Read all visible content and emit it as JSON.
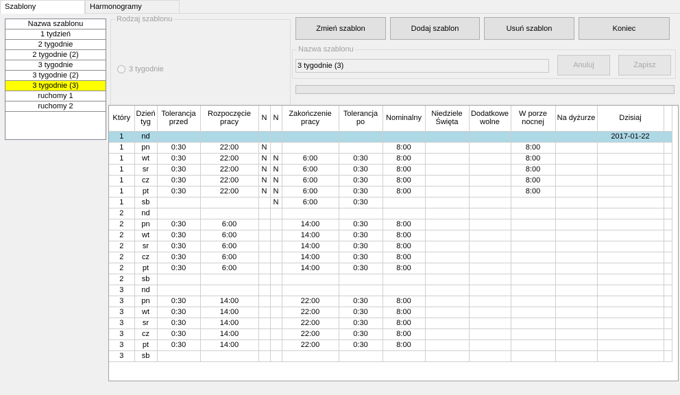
{
  "tabs": [
    {
      "label": "Szablony",
      "active": true
    },
    {
      "label": "Harmonogramy",
      "active": false
    }
  ],
  "template_list": {
    "header": "Nazwa szablonu",
    "items": [
      "1 tydzień",
      "2 tygodnie",
      "2 tygodnie (2)",
      "3 tygodnie",
      "3 tygodnie (2)",
      "3 tygodnie (3)",
      "ruchomy 1",
      "ruchomy 2"
    ],
    "selected_index": 5,
    "selected_color": "#ffff00"
  },
  "template_type": {
    "legend": "Rodzaj szablonu",
    "radio_label": "3 tygodnie"
  },
  "buttons": {
    "change": "Zmień szablon",
    "add": "Dodaj szablon",
    "delete": "Usuń szablon",
    "end": "Koniec",
    "cancel": "Anuluj",
    "save": "Zapisz"
  },
  "name_group": {
    "legend": "Nazwa szablonu",
    "value": "3 tygodnie (3)"
  },
  "grid": {
    "highlight_color": "#add8e6",
    "columns": [
      "Który",
      "Dzień tyg",
      "Tolerancja przed",
      "Rozpoczęcie pracy",
      "N",
      "N",
      "Zakończenie pracy",
      "Tolerancja po",
      "Nominalny",
      "Niedziele Święta",
      "Dodatkowe wolne",
      "W porze nocnej",
      "Na dyżurze",
      "Dzisiaj"
    ],
    "rows": [
      [
        "1",
        "nd",
        "",
        "",
        "",
        "",
        "",
        "",
        "",
        "",
        "",
        "",
        "",
        "2017-01-22"
      ],
      [
        "1",
        "pn",
        "0:30",
        "22:00",
        "N",
        "",
        "",
        "",
        "8:00",
        "",
        "",
        "8:00",
        "",
        ""
      ],
      [
        "1",
        "wt",
        "0:30",
        "22:00",
        "N",
        "N",
        "6:00",
        "0:30",
        "8:00",
        "",
        "",
        "8:00",
        "",
        ""
      ],
      [
        "1",
        "sr",
        "0:30",
        "22:00",
        "N",
        "N",
        "6:00",
        "0:30",
        "8:00",
        "",
        "",
        "8:00",
        "",
        ""
      ],
      [
        "1",
        "cz",
        "0:30",
        "22:00",
        "N",
        "N",
        "6:00",
        "0:30",
        "8:00",
        "",
        "",
        "8:00",
        "",
        ""
      ],
      [
        "1",
        "pt",
        "0:30",
        "22:00",
        "N",
        "N",
        "6:00",
        "0:30",
        "8:00",
        "",
        "",
        "8:00",
        "",
        ""
      ],
      [
        "1",
        "sb",
        "",
        "",
        "",
        "N",
        "6:00",
        "0:30",
        "",
        "",
        "",
        "",
        "",
        ""
      ],
      [
        "2",
        "nd",
        "",
        "",
        "",
        "",
        "",
        "",
        "",
        "",
        "",
        "",
        "",
        ""
      ],
      [
        "2",
        "pn",
        "0:30",
        "6:00",
        "",
        "",
        "14:00",
        "0:30",
        "8:00",
        "",
        "",
        "",
        "",
        ""
      ],
      [
        "2",
        "wt",
        "0:30",
        "6:00",
        "",
        "",
        "14:00",
        "0:30",
        "8:00",
        "",
        "",
        "",
        "",
        ""
      ],
      [
        "2",
        "sr",
        "0:30",
        "6:00",
        "",
        "",
        "14:00",
        "0:30",
        "8:00",
        "",
        "",
        "",
        "",
        ""
      ],
      [
        "2",
        "cz",
        "0:30",
        "6:00",
        "",
        "",
        "14:00",
        "0:30",
        "8:00",
        "",
        "",
        "",
        "",
        ""
      ],
      [
        "2",
        "pt",
        "0:30",
        "6:00",
        "",
        "",
        "14:00",
        "0:30",
        "8:00",
        "",
        "",
        "",
        "",
        ""
      ],
      [
        "2",
        "sb",
        "",
        "",
        "",
        "",
        "",
        "",
        "",
        "",
        "",
        "",
        "",
        ""
      ],
      [
        "3",
        "nd",
        "",
        "",
        "",
        "",
        "",
        "",
        "",
        "",
        "",
        "",
        "",
        ""
      ],
      [
        "3",
        "pn",
        "0:30",
        "14:00",
        "",
        "",
        "22:00",
        "0:30",
        "8:00",
        "",
        "",
        "",
        "",
        ""
      ],
      [
        "3",
        "wt",
        "0:30",
        "14:00",
        "",
        "",
        "22:00",
        "0:30",
        "8:00",
        "",
        "",
        "",
        "",
        ""
      ],
      [
        "3",
        "sr",
        "0:30",
        "14:00",
        "",
        "",
        "22:00",
        "0:30",
        "8:00",
        "",
        "",
        "",
        "",
        ""
      ],
      [
        "3",
        "cz",
        "0:30",
        "14:00",
        "",
        "",
        "22:00",
        "0:30",
        "8:00",
        "",
        "",
        "",
        "",
        ""
      ],
      [
        "3",
        "pt",
        "0:30",
        "14:00",
        "",
        "",
        "22:00",
        "0:30",
        "8:00",
        "",
        "",
        "",
        "",
        ""
      ],
      [
        "3",
        "sb",
        "",
        "",
        "",
        "",
        "",
        "",
        "",
        "",
        "",
        "",
        "",
        ""
      ]
    ],
    "highlighted_row": 0
  }
}
